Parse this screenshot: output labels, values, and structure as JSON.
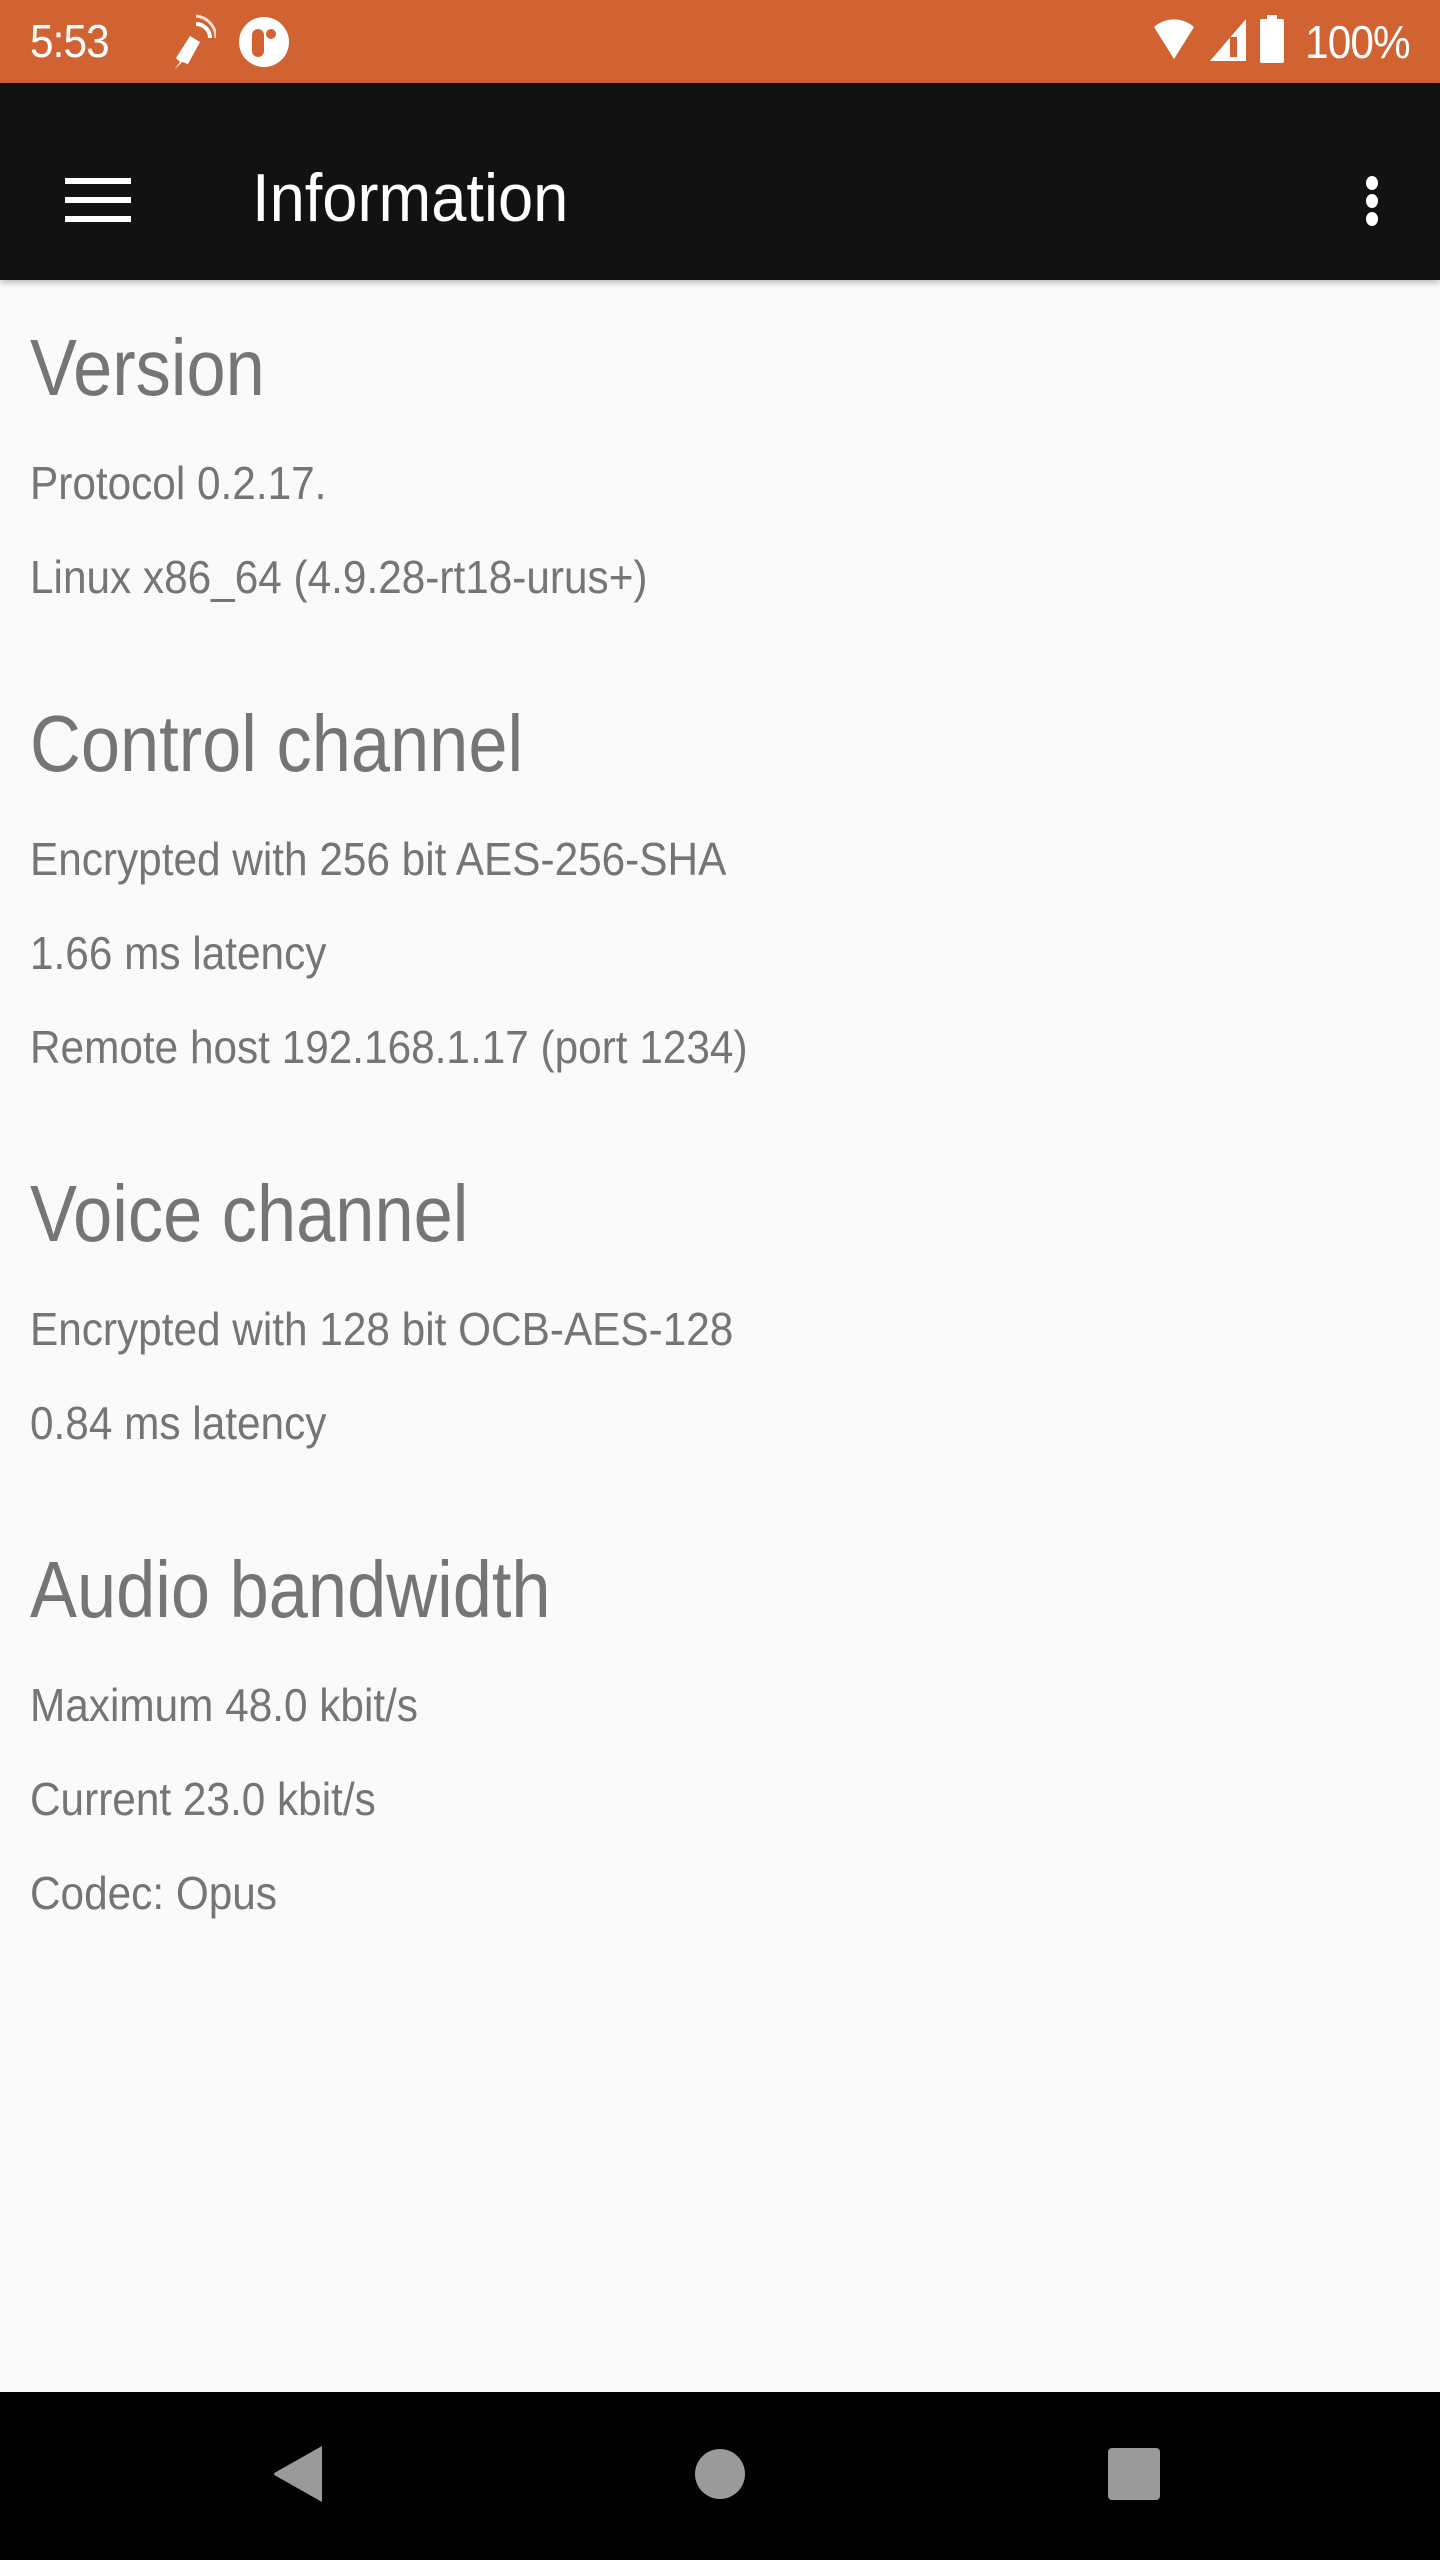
{
  "status_bar": {
    "time": "5:53",
    "notification_icons": [
      "satellite-dish-icon",
      "app-notification-icon"
    ],
    "system_icons": [
      "wifi-icon",
      "cell-signal-icon",
      "battery-icon"
    ],
    "battery_percent": "100%",
    "background_color": "#D16231"
  },
  "app_bar": {
    "title": "Information",
    "menu_icon": "hamburger-menu-icon",
    "overflow_icon": "more-vert-icon",
    "background_color": "#121212"
  },
  "sections": [
    {
      "heading": "Version",
      "lines": [
        "Protocol 0.2.17.",
        "Linux x86_64 (4.9.28-rt18-urus+)"
      ]
    },
    {
      "heading": "Control channel",
      "lines": [
        "Encrypted with 256 bit AES-256-SHA",
        "1.66 ms latency",
        "Remote host 192.168.1.17 (port 1234)"
      ]
    },
    {
      "heading": "Voice channel",
      "lines": [
        "Encrypted with 128 bit OCB-AES-128",
        "0.84 ms latency"
      ]
    },
    {
      "heading": "Audio bandwidth",
      "lines": [
        "Maximum 48.0 kbit/s",
        "Current 23.0 kbit/s",
        "Codec: Opus"
      ]
    }
  ],
  "nav_bar": {
    "buttons": [
      "back-icon",
      "home-icon",
      "recents-icon"
    ]
  },
  "colors": {
    "text_secondary": "#757575",
    "page_background": "#FAFAFA"
  }
}
